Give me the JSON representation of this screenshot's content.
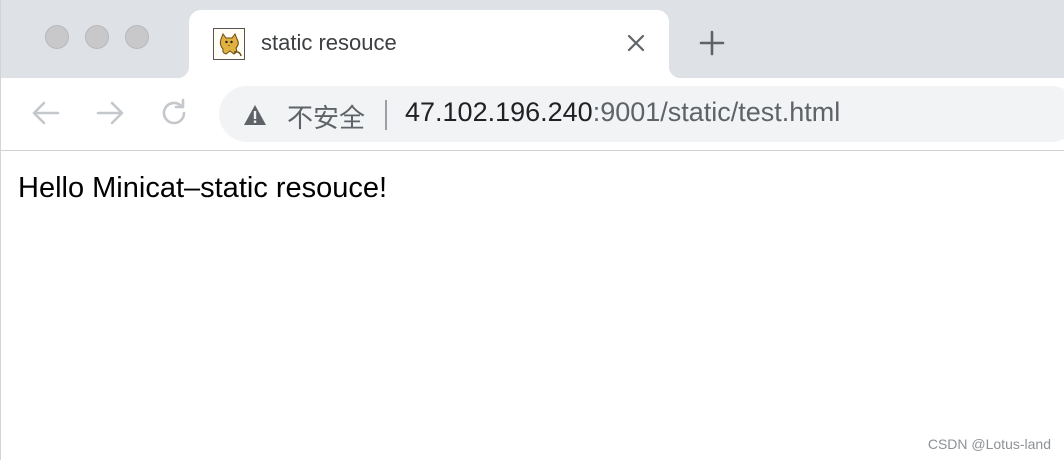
{
  "tab": {
    "title": "static resouce",
    "favicon": "tomcat-cat-icon"
  },
  "toolbar": {
    "back_icon": "back-arrow-icon",
    "forward_icon": "forward-arrow-icon",
    "reload_icon": "reload-icon"
  },
  "omnibox": {
    "security_icon": "warning-triangle-icon",
    "security_label": "不安全",
    "url_host": "47.102.196.240",
    "url_rest": ":9001/static/test.html"
  },
  "page": {
    "body_text": "Hello Minicat–static resouce!"
  },
  "watermark": "CSDN @Lotus-land",
  "colors": {
    "tabstrip_bg": "#dee1e6",
    "omnibox_bg": "#f1f3f4",
    "icon_gray": "#5f6368",
    "disabled_gray": "#c4c7cb"
  }
}
